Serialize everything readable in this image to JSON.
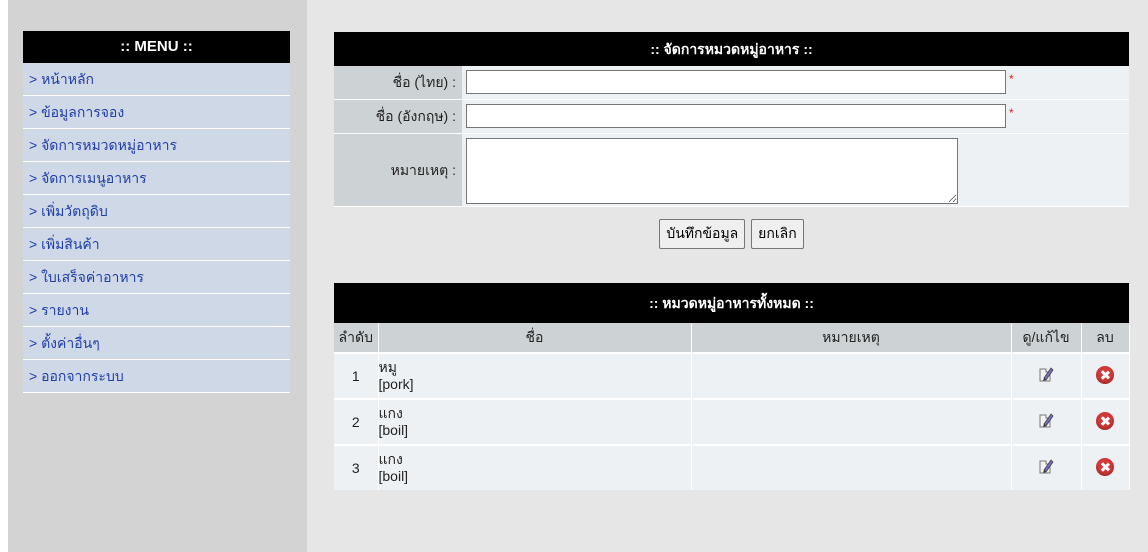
{
  "menu": {
    "title": ":: MENU ::",
    "items": [
      {
        "label": "> หน้าหลัก"
      },
      {
        "label": "> ข้อมูลการจอง"
      },
      {
        "label": "> จัดการหมวดหมู่อาหาร"
      },
      {
        "label": "> จัดการเมนูอาหาร"
      },
      {
        "label": "> เพิ่มวัตถุดิบ"
      },
      {
        "label": "> เพิ่มสินค้า"
      },
      {
        "label": "> ใบเสร็จค่าอาหาร"
      },
      {
        "label": "> รายงาน"
      },
      {
        "label": "> ตั้งค่าอื่นๆ"
      },
      {
        "label": "> ออกจากระบบ"
      }
    ]
  },
  "form": {
    "title": ":: จัดการหมวดหมู่อาหาร ::",
    "name_th_label": "ชื่อ (ไทย) :",
    "name_th_value": "",
    "name_en_label": "ชื่อ (อังกฤษ) :",
    "name_en_value": "",
    "note_label": "หมายเหตุ :",
    "note_value": "",
    "required_mark": "*",
    "save_label": "บันทึกข้อมูล",
    "cancel_label": "ยกเลิก"
  },
  "list": {
    "title": ":: หมวดหมู่อาหารทั้งหมด ::",
    "headers": {
      "no": "ลำดับ",
      "name": "ชื่อ",
      "note": "หมายเหตุ",
      "edit": "ดู/แก้ไข",
      "delete": "ลบ"
    },
    "rows": [
      {
        "no": "1",
        "name_th": "หมู",
        "name_en": "[pork]",
        "note": ""
      },
      {
        "no": "2",
        "name_th": "แกง",
        "name_en": "[boil]",
        "note": ""
      },
      {
        "no": "3",
        "name_th": "แกง",
        "name_en": "[boil]",
        "note": ""
      }
    ],
    "icons": {
      "edit": "edit-pencil-icon",
      "delete": "delete-x-icon"
    }
  },
  "colors": {
    "header_bg": "#000000",
    "menu_item_bg": "#cfd8e6",
    "menu_link": "#1f3ea8",
    "label_bg": "#cdd2d4",
    "required": "#e02020",
    "delete_icon": "#d23a3a"
  }
}
